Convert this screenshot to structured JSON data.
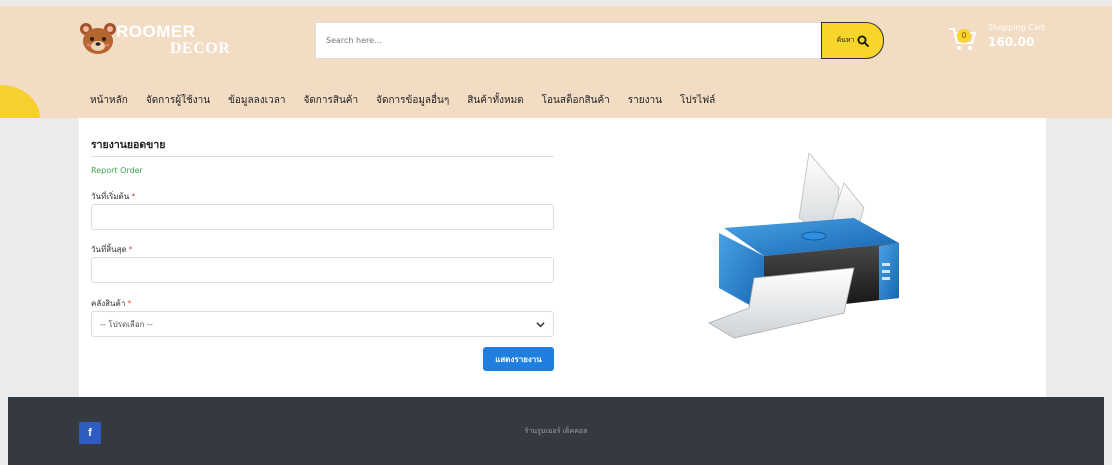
{
  "brand": {
    "line1": "ROOMER",
    "line2": "DECOR"
  },
  "search": {
    "placeholder": "Search here...",
    "button_label": "ค้นหา"
  },
  "cart": {
    "title": "Shopping Cart",
    "total": "160.00",
    "badge": "0"
  },
  "nav": {
    "items": [
      "หน้าหลัก",
      "จัดการผู้ใช้งาน",
      "ข้อมูลลงเวลา",
      "จัดการสินค้า",
      "จัดการข้อมูลอื่นๆ",
      "สินค้าทั้งหมด",
      "โอนสต็อกสินค้า",
      "รายงาน",
      "โปรไฟล์"
    ]
  },
  "form": {
    "title": "รายงานยอดขาย",
    "subtitle": "Report Order",
    "start_label": "วันที่เริ่มต้น",
    "start_value": "",
    "end_label": "วันที่สิ้นสุด",
    "end_value": "",
    "warehouse_label": "คลังสินค้า",
    "warehouse_selected": "-- โปรดเลือก --",
    "required_mark": "*",
    "submit_label": "แสดงรายงาน"
  },
  "footer": {
    "text": "ร้านรูมเมอร์ เด็คคอล",
    "facebook_icon": "f"
  },
  "colors": {
    "header_bg": "#f2dcc4",
    "accent_yellow": "#f7d52b",
    "primary_button": "#1e7fe0",
    "footer_bg": "#343a40",
    "facebook_blue": "#2f5cc1",
    "subtitle_green": "#3aa64d"
  }
}
